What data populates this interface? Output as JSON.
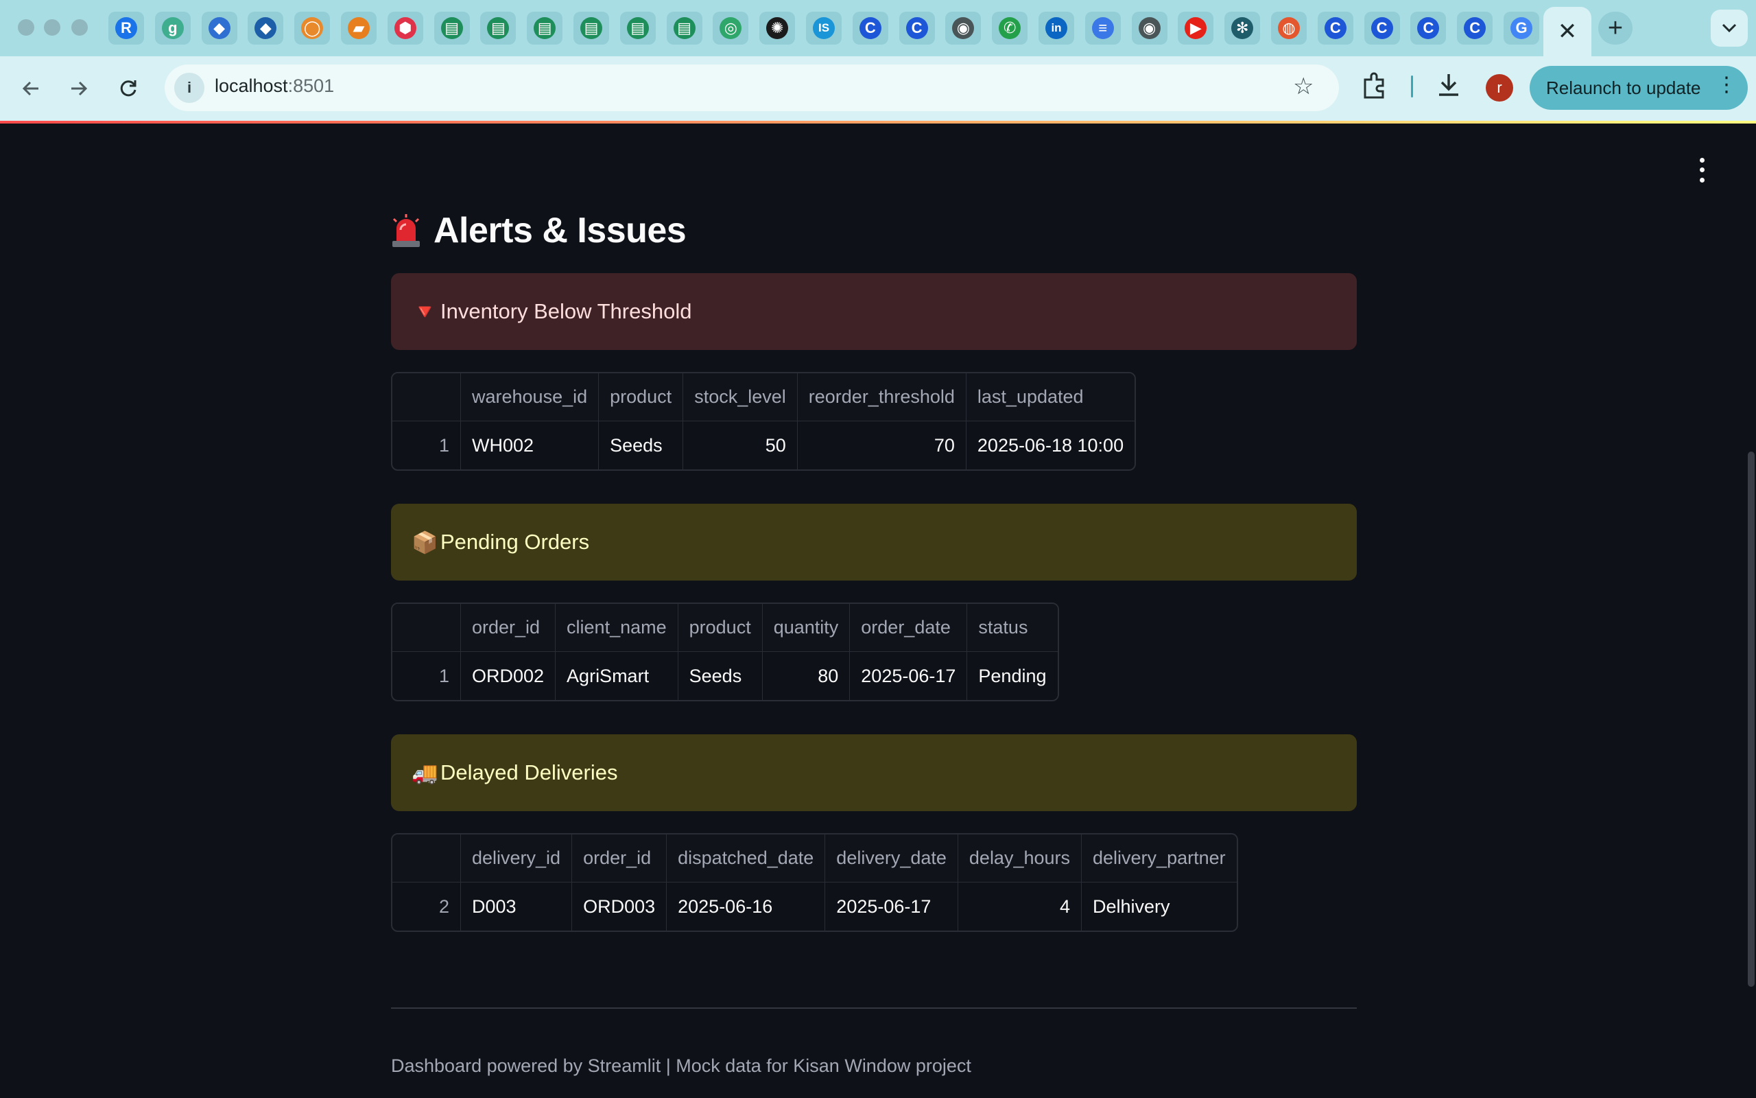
{
  "browser": {
    "url_host": "localhost",
    "url_port": ":8501",
    "relaunch_label": "Relaunch to update",
    "profile_initial": "r",
    "tabs": [
      {
        "icon": "replit-icon",
        "glyph": "R",
        "color": "#1a73e8"
      },
      {
        "icon": "grammar-g-icon",
        "glyph": "g",
        "color": "#3fae8f"
      },
      {
        "icon": "azure-icon",
        "glyph": "◆",
        "color": "#2f6fd1"
      },
      {
        "icon": "diamond-app-icon",
        "glyph": "◆",
        "color": "#1c5fa8"
      },
      {
        "icon": "orange-ring-icon",
        "glyph": "◯",
        "color": "#e8892c"
      },
      {
        "icon": "orange-note-icon",
        "glyph": "▰",
        "color": "#e87f1e"
      },
      {
        "icon": "red-cube-icon",
        "glyph": "⬢",
        "color": "#e0334a"
      },
      {
        "icon": "green-form-icon",
        "glyph": "▤",
        "color": "#1e8e5a"
      },
      {
        "icon": "green-form-icon",
        "glyph": "▤",
        "color": "#1e8e5a"
      },
      {
        "icon": "green-form-icon",
        "glyph": "▤",
        "color": "#1e8e5a"
      },
      {
        "icon": "green-form-icon",
        "glyph": "▤",
        "color": "#1e8e5a"
      },
      {
        "icon": "green-form-icon",
        "glyph": "▤",
        "color": "#1e8e5a"
      },
      {
        "icon": "green-form-icon",
        "glyph": "▤",
        "color": "#1e8e5a"
      },
      {
        "icon": "green-globe-icon",
        "glyph": "◎",
        "color": "#2fa66a"
      },
      {
        "icon": "openai-icon",
        "glyph": "✺",
        "color": "#1b1b1b"
      },
      {
        "icon": "interviewbit-icon",
        "glyph": "IS",
        "color": "#1995d8"
      },
      {
        "icon": "c-app-icon",
        "glyph": "C",
        "color": "#1d56d6"
      },
      {
        "icon": "c-app-icon",
        "glyph": "C",
        "color": "#1d56d6"
      },
      {
        "icon": "chrome-icon",
        "glyph": "◉",
        "color": "#4a5557"
      },
      {
        "icon": "whatsapp-icon",
        "glyph": "✆",
        "color": "#25a04a"
      },
      {
        "icon": "linkedin-icon",
        "glyph": "in",
        "color": "#0a66c2"
      },
      {
        "icon": "docs-icon",
        "glyph": "≡",
        "color": "#3b78e7"
      },
      {
        "icon": "chrome-icon",
        "glyph": "◉",
        "color": "#4a5557"
      },
      {
        "icon": "youtube-icon",
        "glyph": "▶",
        "color": "#e62117"
      },
      {
        "icon": "snowflake-icon",
        "glyph": "✻",
        "color": "#1f5d6b"
      },
      {
        "icon": "basketball-icon",
        "glyph": "◍",
        "color": "#e4572e"
      },
      {
        "icon": "c-app-icon",
        "glyph": "C",
        "color": "#1d56d6"
      },
      {
        "icon": "c-app-icon",
        "glyph": "C",
        "color": "#1d56d6"
      },
      {
        "icon": "c-app-icon",
        "glyph": "C",
        "color": "#1d56d6"
      },
      {
        "icon": "c-app-icon",
        "glyph": "C",
        "color": "#1d56d6"
      },
      {
        "icon": "google-icon",
        "glyph": "G",
        "color": "#4285f4"
      }
    ],
    "active_tab_close": "✕",
    "new_tab": "+"
  },
  "page": {
    "title": "Alerts & Issues",
    "sections": [
      {
        "kind": "error",
        "emoji": "🔻",
        "label": "Inventory Below Threshold",
        "columns": [
          "",
          "warehouse_id",
          "product",
          "stock_level",
          "reorder_threshold",
          "last_updated"
        ],
        "rows": [
          [
            "1",
            "WH002",
            "Seeds",
            "50",
            "70",
            "2025-06-18 10:00"
          ]
        ]
      },
      {
        "kind": "warn",
        "emoji": "📦",
        "label": "Pending Orders",
        "columns": [
          "",
          "order_id",
          "client_name",
          "product",
          "quantity",
          "order_date",
          "status"
        ],
        "rows": [
          [
            "1",
            "ORD002",
            "AgriSmart",
            "Seeds",
            "80",
            "2025-06-17",
            "Pending"
          ]
        ]
      },
      {
        "kind": "warn",
        "emoji": "🚚",
        "label": "Delayed Deliveries",
        "columns": [
          "",
          "delivery_id",
          "order_id",
          "dispatched_date",
          "delivery_date",
          "delay_hours",
          "delivery_partner"
        ],
        "rows": [
          [
            "2",
            "D003",
            "ORD003",
            "2025-06-16",
            "2025-06-17",
            "4",
            "Delhivery"
          ]
        ]
      }
    ],
    "footer": "Dashboard powered by Streamlit | Mock data for Kisan Window project"
  }
}
